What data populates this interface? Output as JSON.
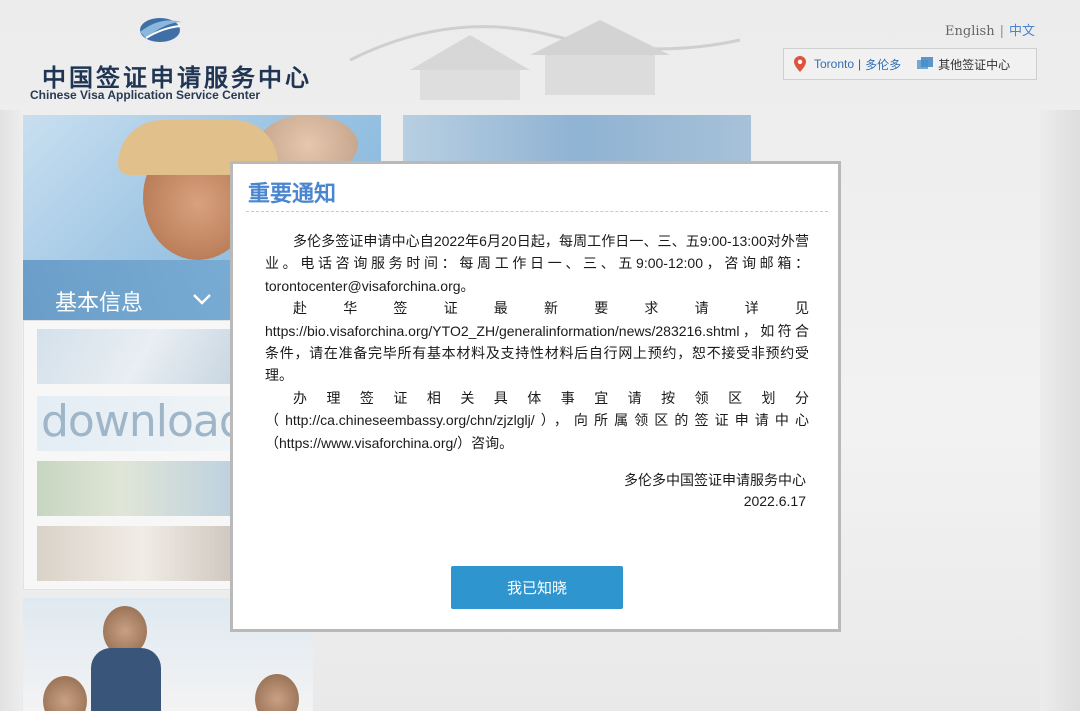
{
  "header": {
    "logo_cn": "中国签证申请服务中心",
    "logo_en": "Chinese Visa Application Service Center",
    "lang_en": "English",
    "lang_sep": "|",
    "lang_zh": "中文"
  },
  "location": {
    "city": "Toronto",
    "sep": "|",
    "city_cn": "多伦多",
    "other_centers": "其他签证中心",
    "pin_color": "#e0523a"
  },
  "sidebar": {
    "hero_label": "基本信息",
    "download_text": "download"
  },
  "notice": {
    "title": "重要通知",
    "p1": "多伦多签证申请中心自2022年6月20日起，每周工作日一、三、五9:00-13:00对外营业。电话咨询服务时间：每周工作日一、三、五9:00-12:00，咨询邮箱：torontocenter@visaforchina.org。",
    "p2_head": "赴 华 签 证 最 新 要 求 请 详 见",
    "p2_tail": "https://bio.visaforchina.org/YTO2_ZH/generalinformation/news/283216.shtml，如符合条件，请在准备完毕所有基本材料及支持性材料后自行网上预约，恕不接受非预约受理。",
    "p3_head": "办 理 签 证 相 关 具 体 事 宜 请 按 领 区 划 分",
    "p3_line2": "（http://ca.chineseembassy.org/chn/zjzlglj/），向所属领区的签证申请中心",
    "p3_tail": "（https://www.visaforchina.org/）咨询。",
    "sign_org": "多伦多中国签证申请服务中心",
    "sign_date": "2022.6.17",
    "button_label": "我已知晓"
  },
  "colors": {
    "accent": "#4a86cf",
    "button": "#2f95cf",
    "link": "#2f6fb5"
  }
}
